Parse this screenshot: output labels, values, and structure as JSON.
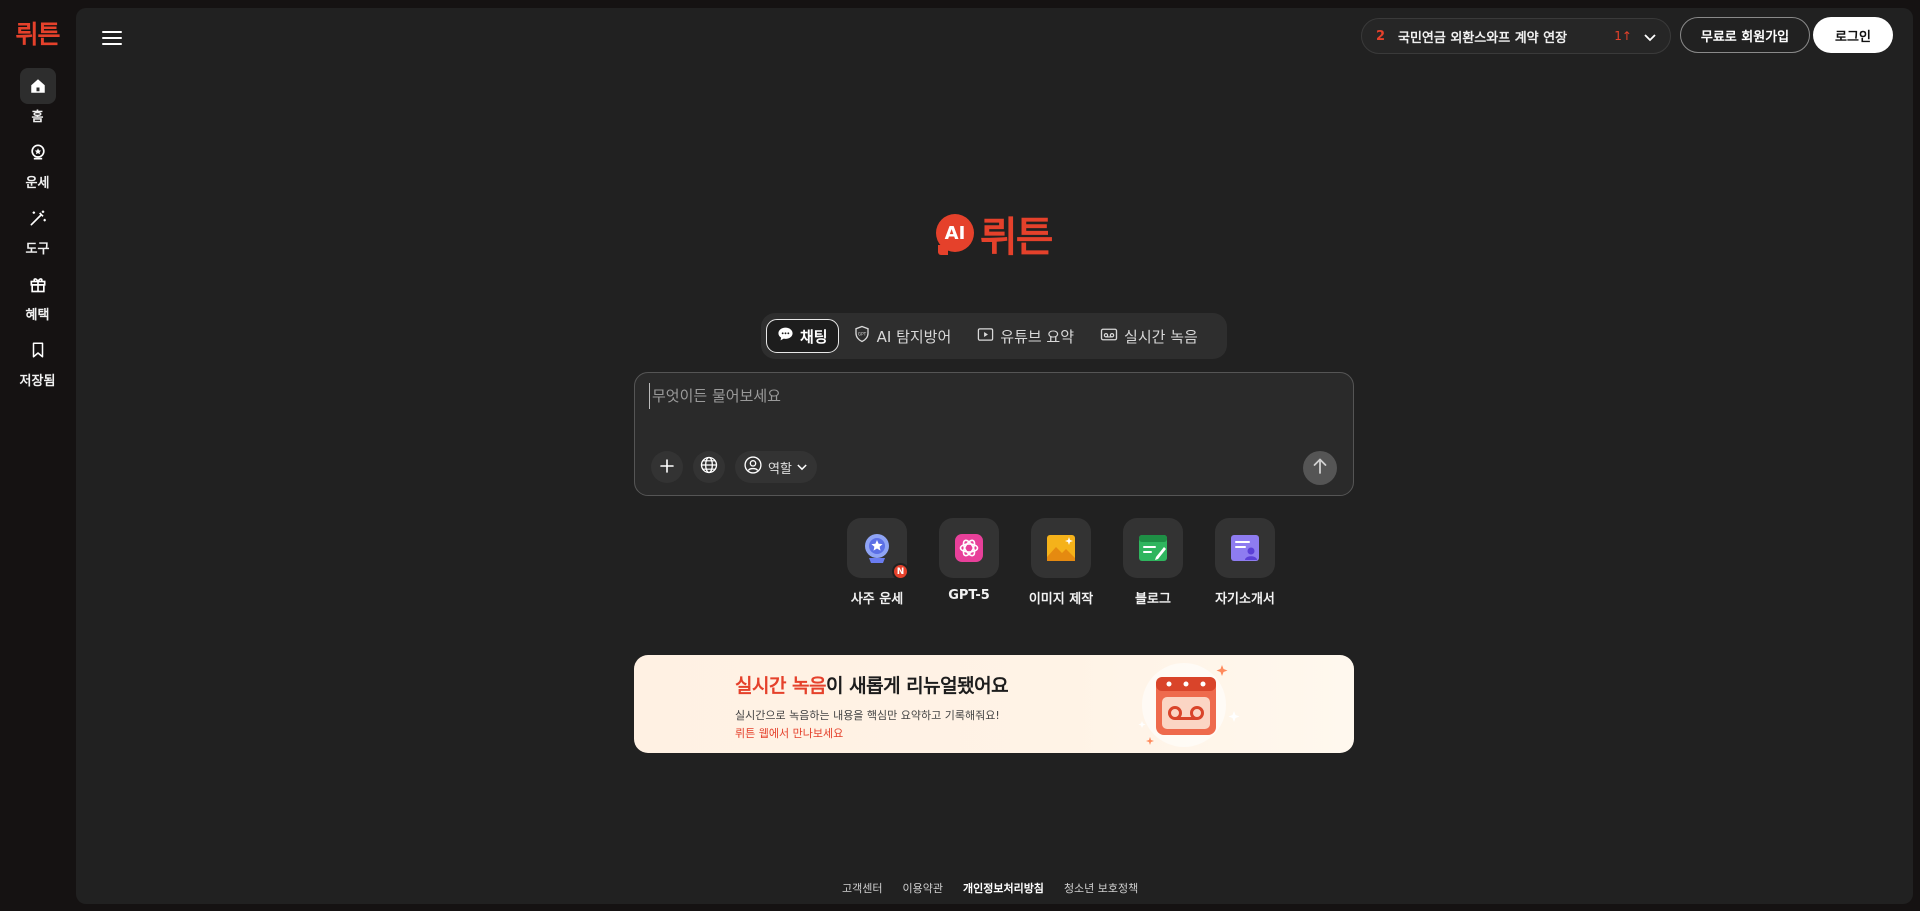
{
  "app": {
    "logo": "뤼튼"
  },
  "sidebar": {
    "items": [
      {
        "label": "홈",
        "icon": "home-icon",
        "active": true
      },
      {
        "label": "운세",
        "icon": "fortune-icon",
        "active": false
      },
      {
        "label": "도구",
        "icon": "magic-wand-icon",
        "active": false
      },
      {
        "label": "혜택",
        "icon": "gift-icon",
        "active": false
      },
      {
        "label": "저장됨",
        "icon": "bookmark-icon",
        "active": false
      }
    ]
  },
  "header": {
    "trending": {
      "rank": "2",
      "text": "국민연금 외환스와프 계약 연장",
      "change": "1↑"
    },
    "signup_label": "무료로 회원가입",
    "login_label": "로그인"
  },
  "brand": {
    "ai_mark": "AI",
    "name": "뤼튼"
  },
  "tabs": [
    {
      "label": "채팅",
      "icon": "chat-bubble-icon",
      "active": true
    },
    {
      "label": "AI 탐지방어",
      "icon": "shield-gpt-icon",
      "active": false
    },
    {
      "label": "유튜브 요약",
      "icon": "play-icon",
      "active": false
    },
    {
      "label": "실시간 녹음",
      "icon": "recorder-icon",
      "active": false
    }
  ],
  "chat": {
    "placeholder": "무엇이든 물어보세요",
    "value": "",
    "role_label": "역할"
  },
  "quick_tools": [
    {
      "label": "사주 운세",
      "icon": "crystal-ball-icon",
      "badge": "N"
    },
    {
      "label": "GPT-5",
      "icon": "gpt-icon"
    },
    {
      "label": "이미지 제작",
      "icon": "image-icon"
    },
    {
      "label": "블로그",
      "icon": "blog-icon"
    },
    {
      "label": "자기소개서",
      "icon": "resume-icon"
    }
  ],
  "banner": {
    "title_highlight": "실시간 녹음",
    "title_rest": "이 새롭게 리뉴얼됐어요",
    "subtitle": "실시간으로 녹음하는 내용을 핵심만 요약하고 기록해줘요!",
    "link": "뤼튼 웹에서 만나보세요"
  },
  "footer": {
    "links": [
      "고객센터",
      "이용약관",
      "개인정보처리방침",
      "청소년 보호정책"
    ]
  },
  "colors": {
    "accent": "#e5412b",
    "background": "#151212",
    "panel": "#212121"
  }
}
